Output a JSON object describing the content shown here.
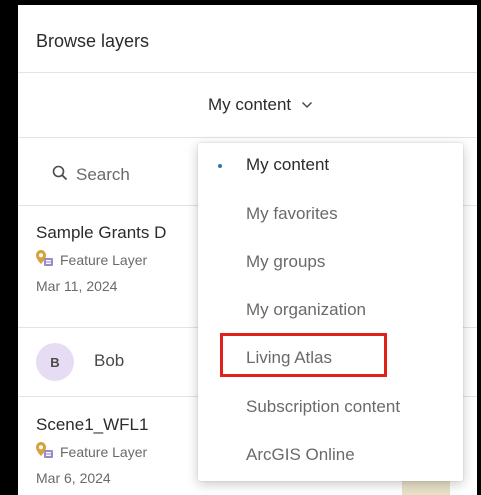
{
  "panel": {
    "title": "Browse layers"
  },
  "source_selector": {
    "label": "My content"
  },
  "search": {
    "placeholder": "Search"
  },
  "items": [
    {
      "title": "Sample Grants D",
      "type": "Feature Layer",
      "date": "Mar 11, 2024"
    },
    {
      "title": "Scene1_WFL1",
      "type": "Feature Layer",
      "date": "Mar 6, 2024"
    }
  ],
  "owner": {
    "initial": "B",
    "name": "Bob"
  },
  "dropdown": {
    "options": [
      {
        "label": "My content",
        "selected": true
      },
      {
        "label": "My favorites",
        "selected": false
      },
      {
        "label": "My groups",
        "selected": false
      },
      {
        "label": "My organization",
        "selected": false
      },
      {
        "label": "Living Atlas",
        "selected": false,
        "highlighted": true
      },
      {
        "label": "Subscription content",
        "selected": false
      },
      {
        "label": "ArcGIS Online",
        "selected": false
      }
    ]
  },
  "colors": {
    "accent": "#2a7ab0",
    "highlight": "#e0201b",
    "avatar_bg": "#e6dcf3"
  },
  "icons": {
    "search": "search-icon",
    "chevron": "chevron-down-icon",
    "layer": "feature-layer-icon"
  }
}
